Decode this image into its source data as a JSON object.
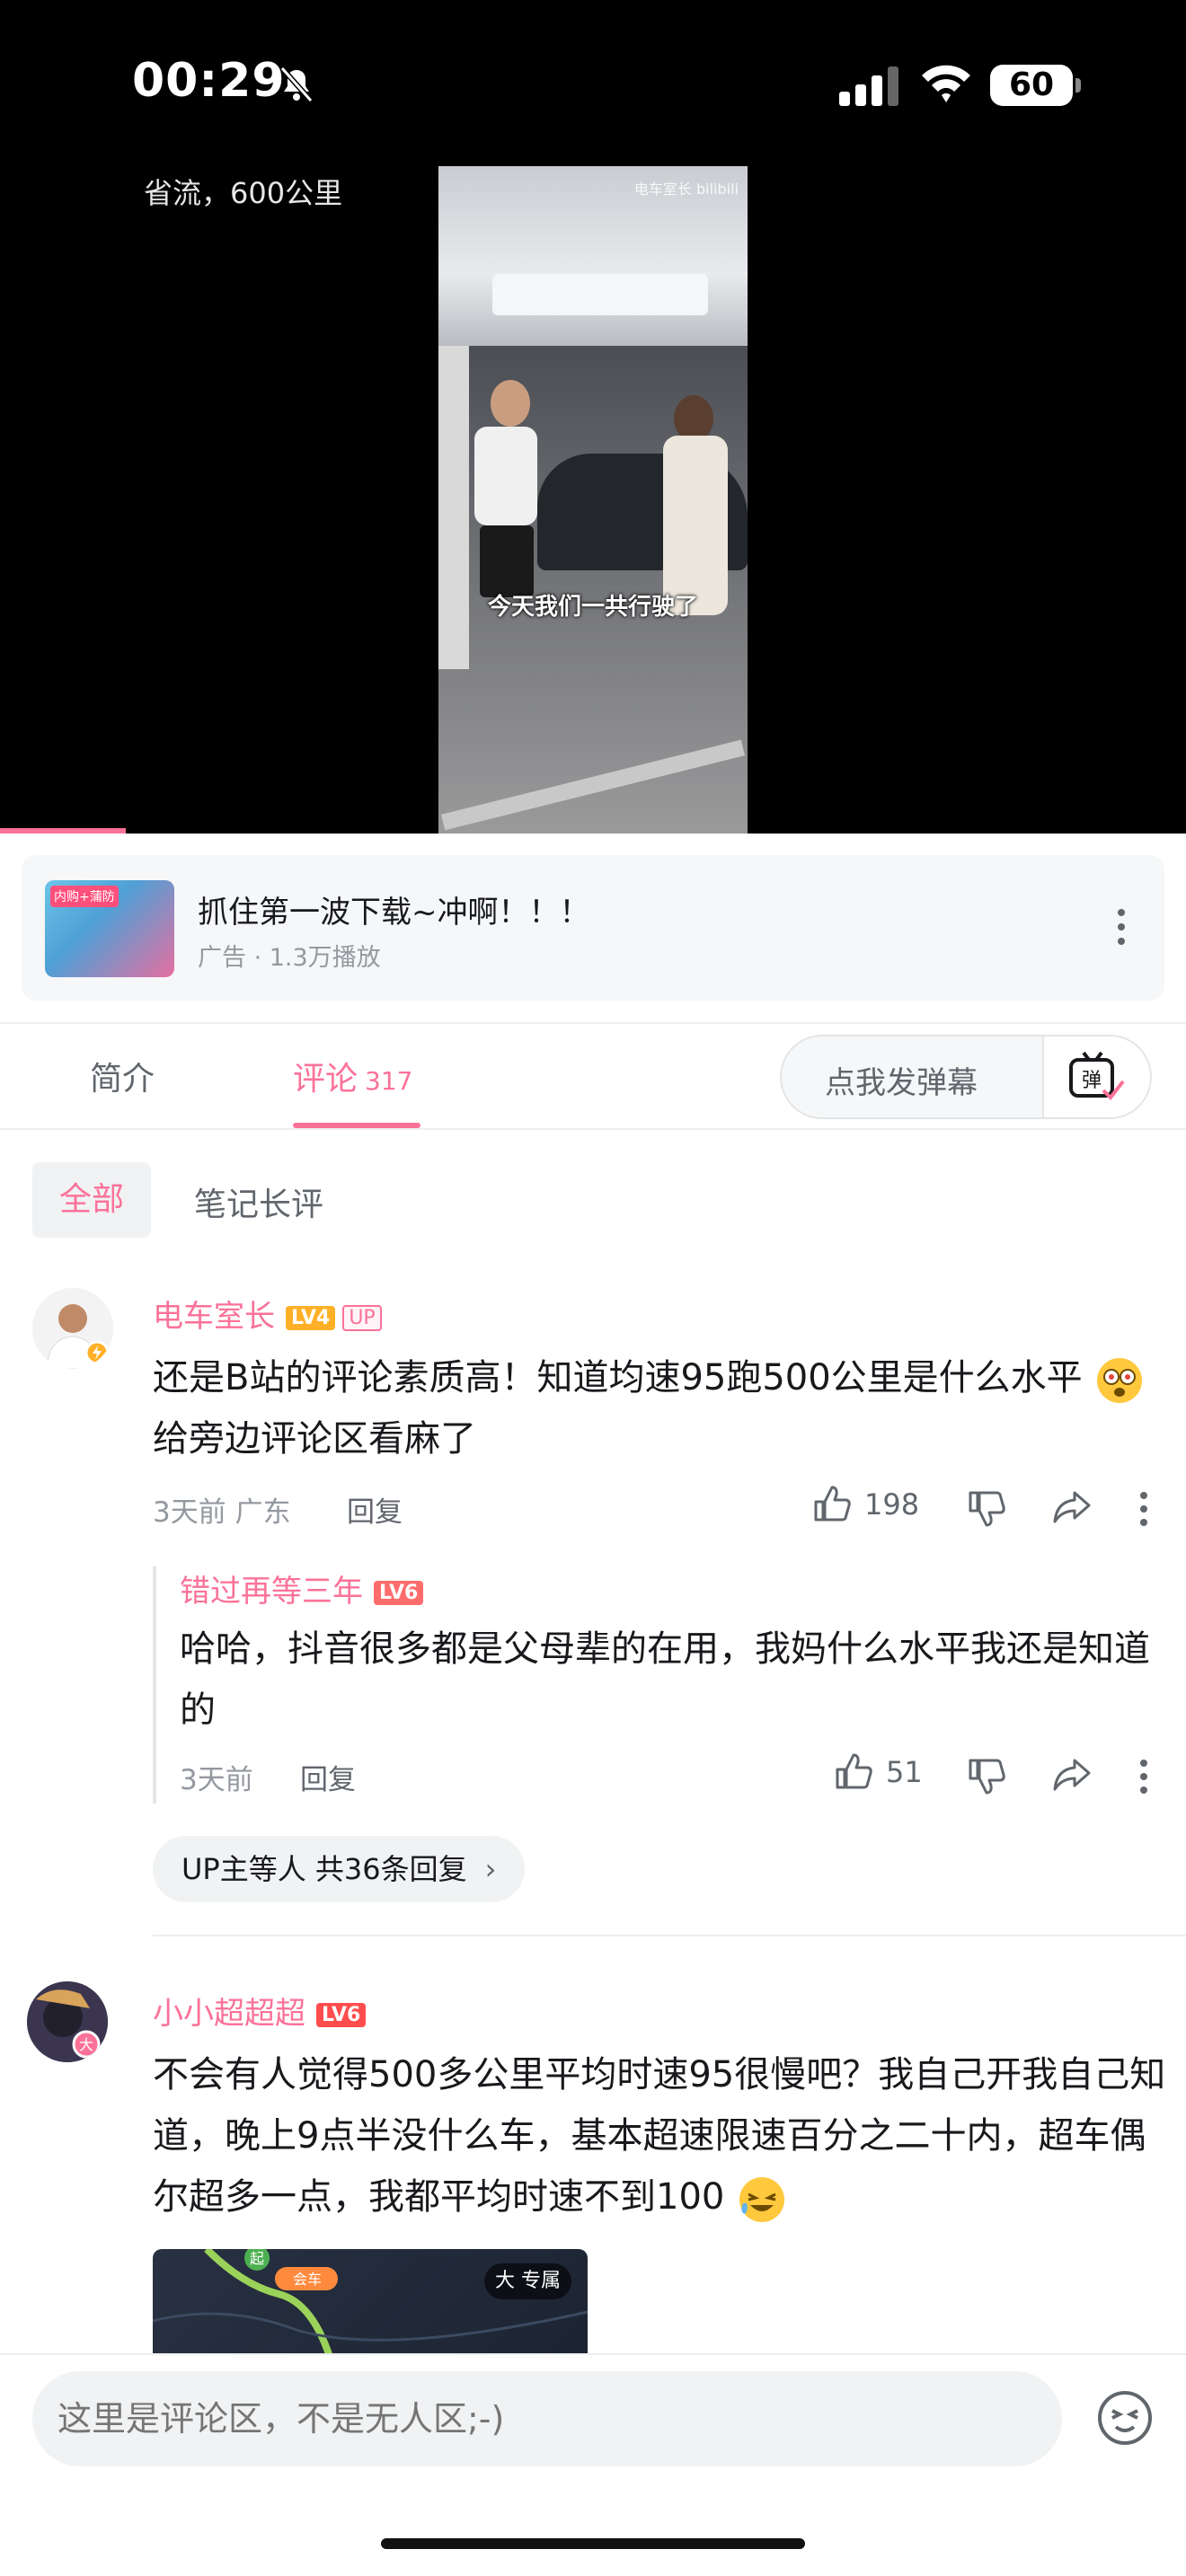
{
  "status_bar": {
    "time": "00:29",
    "battery": "60",
    "icons": [
      "bell-slash-icon",
      "signal-icon",
      "wifi-icon",
      "battery-icon"
    ]
  },
  "video": {
    "title": "省流，600公里",
    "subtitle": "今天我们一共行驶了",
    "watermark": "电车室长 bilibili",
    "progress": 0.106
  },
  "ad": {
    "thumb_tag": "内购+蒲防",
    "title": "抓住第一波下载~冲啊！！！",
    "meta": "广告 · 1.3万播放"
  },
  "tabs": {
    "intro": "简介",
    "comments": "评论",
    "comments_count": "317",
    "danmaku_placeholder": "点我发弹幕",
    "danmaku_icon_label": "弹"
  },
  "sort": {
    "all": "全部",
    "notes": "笔记长评"
  },
  "comments": [
    {
      "user": "电车室长",
      "level": "LV4",
      "badge": "UP",
      "content_part1": "还是B站的评论素质高！知道均速95跑500公里是什么水平",
      "content_part2": "给旁边评论区看麻了",
      "meta": "3天前 广东",
      "reply_label": "回复",
      "likes": "198",
      "reply": {
        "user": "错过再等三年",
        "level": "LV6",
        "content": "哈哈，抖音很多都是父母辈的在用，我妈什么水平我还是知道的",
        "meta": "3天前",
        "reply_label": "回复",
        "likes": "51"
      },
      "more_replies": "UP主等人 共36条回复"
    },
    {
      "user": "小小超超超",
      "level": "LV6",
      "content": "不会有人觉得500多公里平均时速95很慢吧？我自己开我自己知道，晚上9点半没什么车，基本超速限速百分之二十内，超车偶尔超多一点，我都平均时速不到100",
      "map_badge": "大 专属",
      "map_labels": [
        "起",
        "会车"
      ]
    }
  ],
  "input": {
    "placeholder": "这里是评论区，不是无人区;-)"
  },
  "colors": {
    "accent": "#fb7299",
    "text": "#18191c",
    "secondary": "#9499a0"
  }
}
